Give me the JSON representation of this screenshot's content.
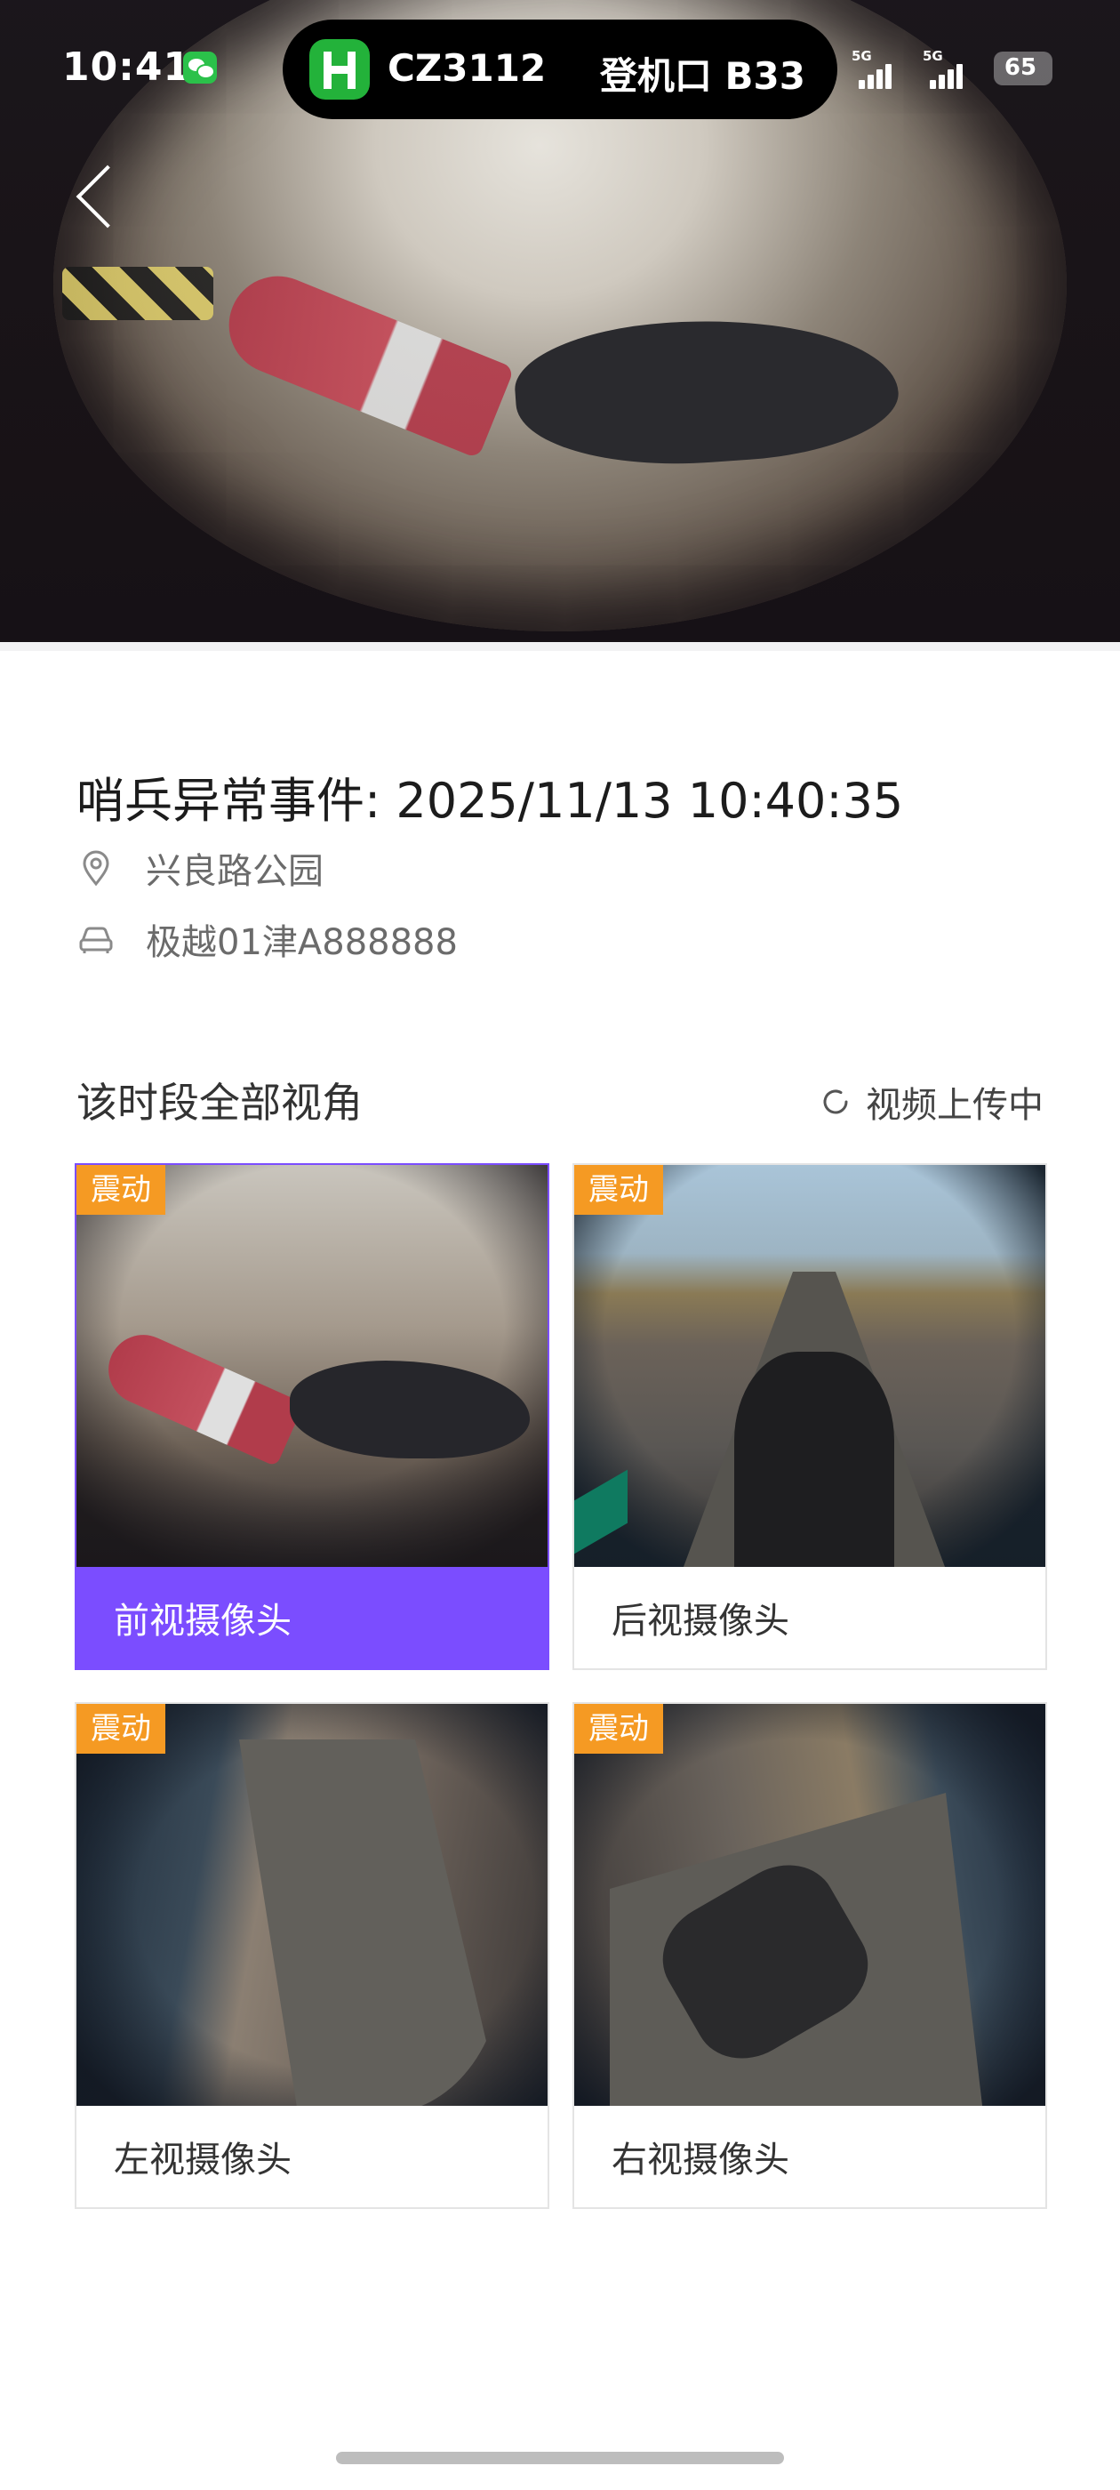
{
  "status_bar": {
    "time": "10:41",
    "flight": {
      "number": "CZ3112",
      "gate": "登机口 B33"
    },
    "signals": [
      {
        "label": "5G"
      },
      {
        "label": "5G"
      }
    ],
    "battery": "65"
  },
  "event": {
    "title": "哨兵异常事件: 2025/11/13 10:40:35",
    "location": "兴良路公园",
    "vehicle": "极越01津A888888"
  },
  "views_section": {
    "title": "该时段全部视角",
    "upload_status": "视频上传中"
  },
  "cameras": [
    {
      "label": "前视摄像头",
      "badge": "震动",
      "active": true
    },
    {
      "label": "后视摄像头",
      "badge": "震动",
      "active": false
    },
    {
      "label": "左视摄像头",
      "badge": "震动",
      "active": false
    },
    {
      "label": "右视摄像头",
      "badge": "震动",
      "active": false
    }
  ],
  "colors": {
    "accent": "#7b4dff",
    "badge": "#f59a23",
    "flight_brand": "#23b23a"
  }
}
